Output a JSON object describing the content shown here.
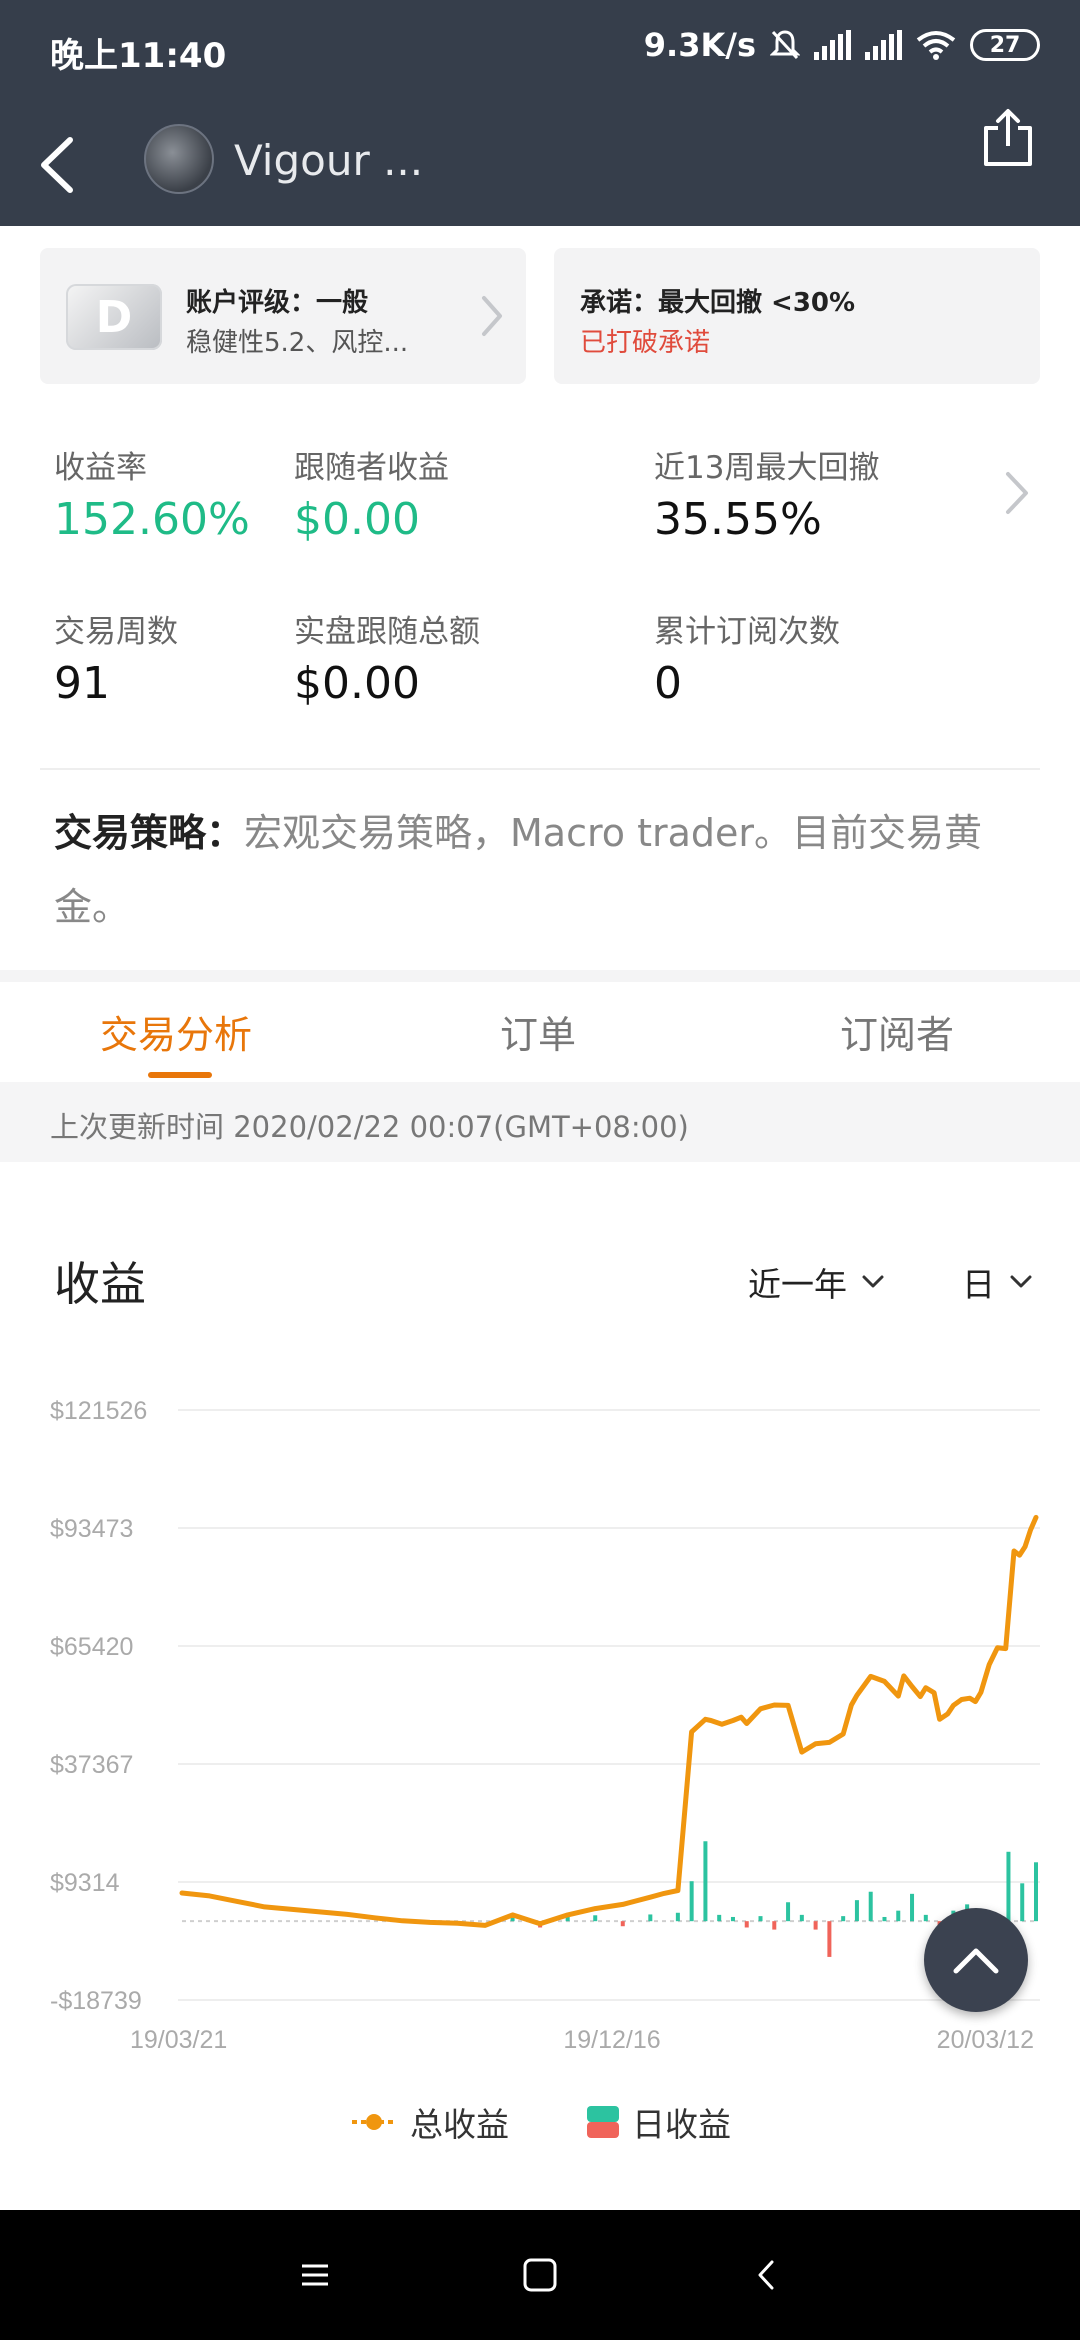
{
  "status_bar": {
    "time": "晚上11:40",
    "net_speed": "9.3K/s",
    "battery": "27",
    "icons": [
      "bell-off-icon",
      "hd-signal-icon",
      "hd-signal-icon",
      "wifi-icon",
      "battery-icon"
    ]
  },
  "header": {
    "title": "Vigour ...",
    "back_icon": "chevron-left-icon",
    "share_icon": "share-icon"
  },
  "rating_card": {
    "badge": "D",
    "title": "账户评级：一般",
    "subtitle": "稳健性5.2、风控..."
  },
  "promise_card": {
    "title": "承诺：最大回撤 <30%",
    "status": "已打破承诺",
    "status_color": "#e04b3c"
  },
  "stats": {
    "return_rate": {
      "label": "收益率",
      "value": "152.60%"
    },
    "follower_profit": {
      "label": "跟随者收益",
      "value": "$0.00"
    },
    "max_drawdown": {
      "label": "近13周最大回撤",
      "value": "35.55%"
    },
    "trade_weeks": {
      "label": "交易周数",
      "value": "91"
    },
    "live_follow_total": {
      "label": "实盘跟随总额",
      "value": "$0.00"
    },
    "subscriptions": {
      "label": "累计订阅次数",
      "value": "0"
    }
  },
  "strategy": {
    "label": "交易策略：",
    "text": "宏观交易策略，Macro trader。目前交易黄金。"
  },
  "tabs": [
    {
      "label": "交易分析",
      "active": true
    },
    {
      "label": "订单",
      "active": false
    },
    {
      "label": "订阅者",
      "active": false
    }
  ],
  "update_time": "上次更新时间 2020/02/22 00:07(GMT+08:00)",
  "chart_section": {
    "title": "收益",
    "range_select": "近一年",
    "interval_select": "日"
  },
  "colors": {
    "accent": "#e8760a",
    "green": "#1fbb87",
    "line": "#f0960f",
    "bar_up": "#2cc3a0",
    "bar_down": "#f0645a"
  },
  "chart_data": {
    "type": "line",
    "y_ticks": [
      "$121526",
      "$93473",
      "$65420",
      "$37367",
      "$9314",
      "-$18739"
    ],
    "ylim": [
      -18739,
      121526
    ],
    "x_ticks": [
      "19/03/21",
      "19/12/16",
      "20/03/12"
    ],
    "grid": true,
    "legend_position": "bottom",
    "series": [
      {
        "name": "总收益",
        "color": "#f0960f",
        "x": [
          0,
          10,
          20,
          30,
          40,
          50,
          60,
          70,
          80,
          90,
          100,
          110,
          120,
          130,
          140,
          150,
          160,
          170,
          175,
          180,
          185,
          190,
          192,
          196,
          200,
          203,
          205,
          210,
          215,
          220,
          225,
          230,
          235,
          240,
          243,
          245,
          250,
          255,
          260,
          262,
          265,
          268,
          270,
          273,
          275,
          278,
          280,
          283,
          286,
          288,
          290,
          293,
          296,
          299,
          302,
          304,
          306,
          308,
          310
        ],
        "values": [
          6700,
          6000,
          4700,
          3400,
          2800,
          2200,
          1600,
          800,
          100,
          -300,
          -500,
          -1000,
          1500,
          -600,
          1500,
          3000,
          4000,
          5700,
          6600,
          7300,
          45000,
          48000,
          47700,
          46800,
          47700,
          48500,
          47000,
          50500,
          51400,
          51300,
          40200,
          42200,
          42500,
          44500,
          51400,
          53700,
          58200,
          57000,
          53500,
          58300,
          55800,
          53400,
          55500,
          54300,
          48000,
          49300,
          51300,
          52700,
          53000,
          52200,
          54400,
          61000,
          65000,
          64800,
          88000,
          87000,
          89000,
          93000,
          96000
        ]
      },
      {
        "name": "日收益",
        "type": "bar",
        "color_up": "#2cc3a0",
        "color_down": "#f0645a",
        "x": [
          120,
          130,
          140,
          150,
          160,
          170,
          180,
          185,
          190,
          195,
          200,
          205,
          210,
          215,
          220,
          225,
          230,
          235,
          240,
          245,
          250,
          255,
          260,
          265,
          270,
          275,
          280,
          285,
          290,
          295,
          300,
          305,
          310
        ],
        "values": [
          1500,
          -1500,
          1800,
          1400,
          -1200,
          1600,
          2000,
          9500,
          19000,
          1500,
          1000,
          -1500,
          1200,
          -2000,
          4500,
          1500,
          -2000,
          -8500,
          1200,
          5000,
          7000,
          1000,
          2500,
          6500,
          1500,
          -6500,
          2500,
          4000,
          2000,
          1200,
          16500,
          9000,
          14000
        ]
      }
    ]
  },
  "fab_icon": "chevron-up-icon",
  "nav_bar": {
    "icons": [
      "menu-icon",
      "home-square-icon",
      "back-icon"
    ]
  }
}
